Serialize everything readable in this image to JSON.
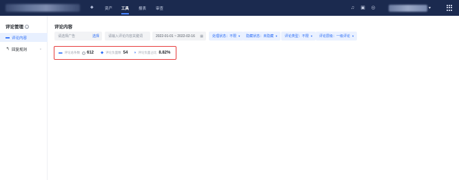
{
  "topbar": {
    "nav": [
      {
        "label": "资产",
        "active": false
      },
      {
        "label": "工具",
        "active": true
      },
      {
        "label": "报表",
        "active": false
      },
      {
        "label": "审查",
        "active": false
      }
    ],
    "icons": [
      "bell-icon",
      "save-icon",
      "help-icon",
      "avatar-icon",
      "apps-grid-icon"
    ],
    "accent": "#2a6cf6",
    "bg_color": "#1b2a4f"
  },
  "sidebar": {
    "title": "评论管理",
    "items": [
      {
        "label": "评论内容",
        "icon": "comment-icon",
        "active": true
      },
      {
        "label": "回复规则",
        "icon": "reply-icon",
        "active": false
      }
    ]
  },
  "main": {
    "title": "评论内容",
    "filters": {
      "ad_select_placeholder": "请选择广告",
      "ad_select_link": "选择",
      "search_placeholder": "请输入评论内容关键词",
      "date_range": "2022-01-01 ~ 2022-02-16",
      "process_status": "处理状态：不限",
      "hidden_status": "隐藏状态：未隐藏",
      "comment_type": "评论类型：不限",
      "comment_level": "评论层级：一级评论"
    },
    "stats": [
      {
        "label": "评论总条数",
        "value": "612",
        "icon": "comment-icon",
        "has_help": true
      },
      {
        "label": "评论负面数",
        "value": "54",
        "icon": "negative-icon",
        "has_help": false
      },
      {
        "label": "评论负面占比",
        "value": "8.82%",
        "icon": "ratio-icon",
        "has_help": false
      }
    ],
    "highlight_color": "#e63a3a"
  }
}
